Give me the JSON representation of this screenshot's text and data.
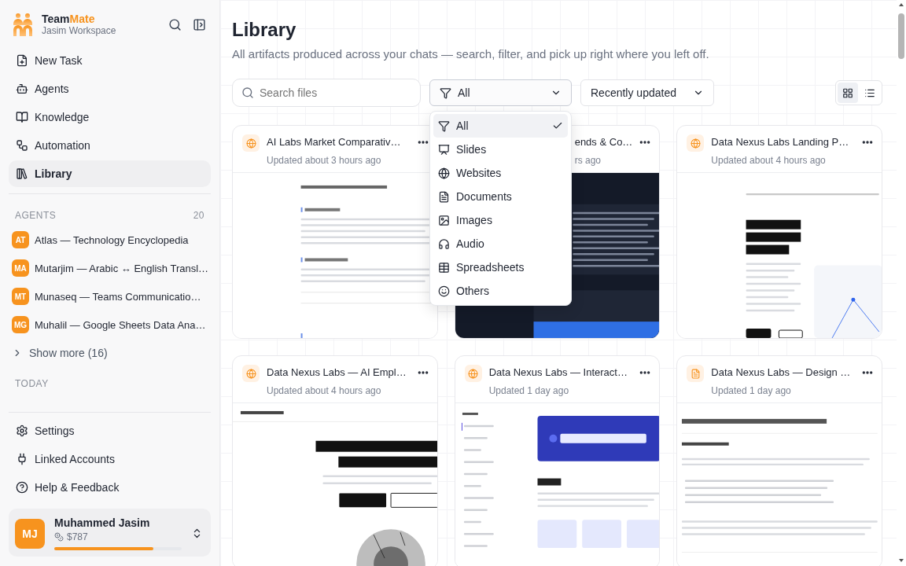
{
  "sidebar": {
    "brand_prefix": "Team",
    "brand_suffix": "Mate",
    "workspace": "Jasim Workspace",
    "nav": [
      {
        "label": "New Task",
        "selected": false
      },
      {
        "label": "Agents",
        "selected": false
      },
      {
        "label": "Knowledge",
        "selected": false
      },
      {
        "label": "Automation",
        "selected": false
      },
      {
        "label": "Library",
        "selected": true
      }
    ],
    "agents_heading": "AGENTS",
    "agents_count": "20",
    "agents": [
      {
        "initials": "AT",
        "name": "Atlas — Technology Encyclopedia"
      },
      {
        "initials": "MA",
        "name": "Mutarjim — Arabic ↔ English Transl…"
      },
      {
        "initials": "MT",
        "name": "Munaseq — Teams Communicatio…"
      },
      {
        "initials": "MG",
        "name": "Muhalil — Google Sheets Data Ana…"
      }
    ],
    "show_more": "Show more (16)",
    "today_heading": "TODAY",
    "footer_items": [
      "Settings",
      "Linked Accounts",
      "Help & Feedback"
    ],
    "user": {
      "initials": "MJ",
      "name": "Muhammed Jasim",
      "credits": "$787",
      "level": 0.78
    }
  },
  "main": {
    "title": "Library",
    "subtitle": "All artifacts produced across your chats — search, filter, and pick up right where you left off.",
    "search": {
      "placeholder": "Search files"
    },
    "filter": {
      "value": "All",
      "expanded": true,
      "options": [
        {
          "label": "All",
          "selected": true
        },
        {
          "label": "Slides",
          "selected": false
        },
        {
          "label": "Websites",
          "selected": false
        },
        {
          "label": "Documents",
          "selected": false
        },
        {
          "label": "Images",
          "selected": false
        },
        {
          "label": "Audio",
          "selected": false
        },
        {
          "label": "Spreadsheets",
          "selected": false
        },
        {
          "label": "Others",
          "selected": false
        }
      ]
    },
    "sort": {
      "value": "Recently updated"
    },
    "views": [
      {
        "kind": "grid",
        "selected": true
      },
      {
        "kind": "list",
        "selected": false
      }
    ],
    "cards": [
      {
        "kind": "website",
        "title": "AI Labs Market Comparativ…",
        "updated": "Updated about 3 hours ago"
      },
      {
        "title": "ends & Co…",
        "updated": "rs ago"
      },
      {
        "kind": "website",
        "title": "Data Nexus Labs Landing P…",
        "updated": "Updated about 4 hours ago"
      },
      {
        "kind": "website",
        "title": "Data Nexus Labs — AI Empl…",
        "updated": "Updated about 4 hours ago"
      },
      {
        "kind": "website",
        "title": "Data Nexus Labs — Interact…",
        "updated": "Updated 1 day ago"
      },
      {
        "kind": "document",
        "title": "Data Nexus Labs — Design …",
        "updated": "Updated 1 day ago"
      }
    ]
  }
}
